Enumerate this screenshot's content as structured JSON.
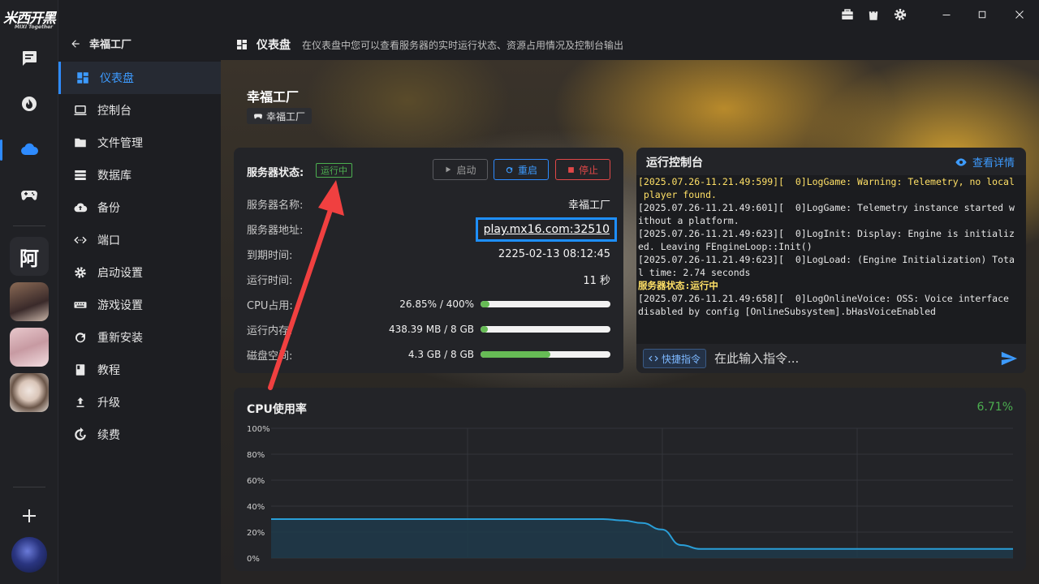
{
  "app": {
    "logo_text": "米西开黑",
    "logo_sub": "MIXI Together"
  },
  "rail": {
    "avatar_text": "阿"
  },
  "nav": {
    "back_title": "幸福工厂",
    "items": [
      {
        "label": "仪表盘",
        "icon": "dashboard-icon",
        "active": true
      },
      {
        "label": "控制台",
        "icon": "laptop-icon"
      },
      {
        "label": "文件管理",
        "icon": "folder-icon"
      },
      {
        "label": "数据库",
        "icon": "database-icon"
      },
      {
        "label": "备份",
        "icon": "cloud-upload-icon"
      },
      {
        "label": "端口",
        "icon": "port-icon"
      },
      {
        "label": "启动设置",
        "icon": "gear-icon"
      },
      {
        "label": "游戏设置",
        "icon": "keyboard-icon"
      },
      {
        "label": "重新安装",
        "icon": "refresh-icon"
      },
      {
        "label": "教程",
        "icon": "book-icon"
      },
      {
        "label": "升级",
        "icon": "upload-icon"
      },
      {
        "label": "续费",
        "icon": "renew-icon"
      }
    ]
  },
  "subbar": {
    "title": "仪表盘",
    "description": "在仪表盘中您可以查看服务器的实时运行状态、资源占用情况及控制台输出"
  },
  "server": {
    "title": "幸福工厂",
    "tag": "幸福工厂"
  },
  "status": {
    "label": "服务器状态:",
    "badge": "运行中",
    "btn_start": "启动",
    "btn_restart": "重启",
    "btn_stop": "停止",
    "name_label": "服务器名称:",
    "name_value": "幸福工厂",
    "addr_label": "服务器地址:",
    "addr_value": "play.mx16.com:32510",
    "expire_label": "到期时间:",
    "expire_value": "2225-02-13 08:12:45",
    "uptime_label": "运行时间:",
    "uptime_value": "11 秒",
    "cpu_label": "CPU占用:",
    "cpu_value": "26.85% / 400%",
    "cpu_pct": 6.7,
    "mem_label": "运行内存:",
    "mem_value": "438.39 MB / 8 GB",
    "mem_pct": 5.4,
    "disk_label": "磁盘空间:",
    "disk_value": "4.3 GB / 8 GB",
    "disk_pct": 53.75
  },
  "console": {
    "title": "运行控制台",
    "detail": "查看详情",
    "lines": [
      {
        "text": "[2025.07.26-11.21.49:599][  0]LogGame: Warning: Telemetry, no local",
        "cls": "warn"
      },
      {
        "text": " player found.",
        "cls": "warn"
      },
      {
        "text": "[2025.07.26-11.21.49:601][  0]LogGame: Telemetry instance started w",
        "cls": ""
      },
      {
        "text": "ithout a platform.",
        "cls": ""
      },
      {
        "text": "[2025.07.26-11.21.49:623][  0]LogInit: Display: Engine is initializ",
        "cls": ""
      },
      {
        "text": "ed. Leaving FEngineLoop::Init()",
        "cls": ""
      },
      {
        "text": "[2025.07.26-11.21.49:623][  0]LogLoad: (Engine Initialization) Tota",
        "cls": ""
      },
      {
        "text": "l time: 2.74 seconds",
        "cls": ""
      },
      {
        "text": "服务器状态:运行中",
        "cls": "ok"
      },
      {
        "text": "[2025.07.26-11.21.49:658][  0]LogOnlineVoice: OSS: Voice interface",
        "cls": ""
      },
      {
        "text": "disabled by config [OnlineSubsystem].bHasVoiceEnabled",
        "cls": ""
      }
    ],
    "quick_btn": "快捷指令",
    "input_placeholder": "在此输入指令..."
  },
  "chart_data": {
    "type": "area",
    "title": "CPU使用率",
    "current_value": "6.71%",
    "y_ticks": [
      "100%",
      "80%",
      "60%",
      "40%",
      "20%",
      "0%"
    ],
    "ylim": [
      0,
      100
    ],
    "x": [
      0,
      1,
      2,
      3,
      4,
      5,
      6,
      7,
      8,
      9,
      10,
      11,
      12,
      13,
      14,
      15,
      16,
      17,
      18,
      19,
      20,
      21,
      22,
      23,
      24,
      25,
      26,
      27,
      28,
      29,
      30,
      31,
      32,
      33,
      34,
      35,
      36,
      37,
      38
    ],
    "values": [
      30,
      30,
      30,
      30,
      30,
      30,
      30,
      30,
      30,
      30,
      30,
      30,
      30,
      30,
      30,
      30,
      30,
      30,
      29,
      27,
      22,
      10,
      7,
      7,
      7,
      7,
      7,
      7,
      7,
      7,
      7,
      7,
      7,
      7,
      7,
      7,
      7,
      7,
      7
    ],
    "grid": true,
    "colors": {
      "line": "#2a9fd8",
      "fill": "#1f3a4a"
    }
  }
}
